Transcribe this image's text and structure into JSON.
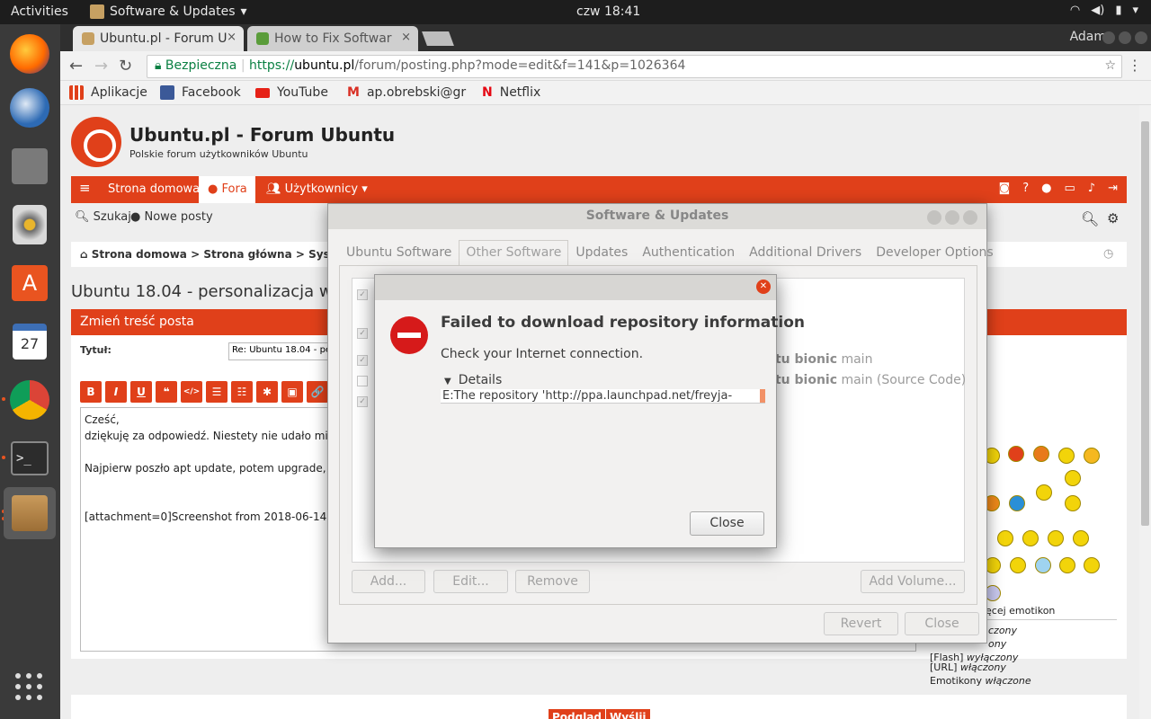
{
  "topbar": {
    "activities": "Activities",
    "app_name": "Software & Updates",
    "clock": "czw 18:41"
  },
  "dock": {
    "items": [
      "Firefox",
      "Thunderbird",
      "Files",
      "Rhythmbox",
      "Ubuntu Software",
      "Calendar",
      "Chrome",
      "Terminal",
      "Software & Updates"
    ],
    "calendar_day": "27"
  },
  "browser": {
    "tabs": [
      {
        "label": "Ubuntu.pl - Forum U",
        "close": "×"
      },
      {
        "label": "How to Fix Softwar",
        "close": "×"
      }
    ],
    "user": "Adam",
    "address": {
      "secure_label": "Bezpieczna",
      "scheme": "https://",
      "host": "ubuntu.pl",
      "path": "/forum/posting.php?mode=edit&f=141&p=1026364"
    },
    "bookmarks": [
      {
        "label": "Aplikacje",
        "color": "#e0401a"
      },
      {
        "label": "Facebook",
        "color": "#3b5998"
      },
      {
        "label": "YouTube",
        "color": "#e62117"
      },
      {
        "label": "ap.obrebski@gr",
        "color": "#d93025"
      },
      {
        "label": "Netflix",
        "color": "#e50914"
      }
    ]
  },
  "forum": {
    "title": "Ubuntu.pl - Forum Ubuntu",
    "subtitle": "Polskie forum użytkowników Ubuntu",
    "nav": [
      "Strona domowa",
      "Fora",
      "Użytkownicy"
    ],
    "search": "Szukaj",
    "new_posts": "Nowe posty",
    "breadcrumb": "Strona domowa > Strona główna > System > Środ",
    "topic_title": "Ubuntu 18.04 - personalizacja wyg",
    "edit_header": "Zmień treść posta",
    "tytul_label": "Tytuł:",
    "tytul_value": "Re: Ubuntu 18.04 - pe",
    "fmt_buttons": [
      "B",
      "I",
      "U",
      "❝",
      "</>",
      "☰",
      "☷",
      "✱",
      "▣",
      "🔗"
    ],
    "post_lines": [
      "Cześć,",
      "dziękuję za odpowiedź. Niestety nie udało mi s",
      "",
      "Najpierw poszło apt update, potem upgrade, a",
      "",
      "",
      "[attachment=0]Screenshot from 2018-06-14 18"
    ],
    "more_emoticons": "ęcej emotikon",
    "side_lines": [
      {
        "prefix": "",
        "value": "czony"
      },
      {
        "prefix": "",
        "value": "ony"
      },
      {
        "prefix": "[Flash] ",
        "value": "wyłączony"
      },
      {
        "prefix": "[URL] ",
        "value": "włączony"
      },
      {
        "prefix": "Emotikony ",
        "value": "włączone"
      }
    ],
    "preview_button": "Podgląd",
    "submit_button": "Wyślij"
  },
  "software_window": {
    "title": "Software & Updates",
    "tabs": [
      "Ubuntu Software",
      "Other Software",
      "Updates",
      "Authentication",
      "Additional Drivers",
      "Developer Options"
    ],
    "active_tab": "Other Software",
    "rows": [
      {
        "checked": true,
        "distro": "",
        "component": ""
      },
      {
        "checked": true,
        "distro": "",
        "component": ""
      },
      {
        "checked": true,
        "distro": "ntu bionic",
        "component": "main"
      },
      {
        "checked": false,
        "distro": "ntu bionic",
        "component": "main (Source Code)"
      },
      {
        "checked": true,
        "distro": "",
        "component": ""
      }
    ],
    "buttons": {
      "add": "Add...",
      "edit": "Edit...",
      "remove": "Remove",
      "add_volume": "Add Volume..."
    },
    "footer": {
      "revert": "Revert",
      "close": "Close"
    }
  },
  "error_dialog": {
    "title": "Failed to download repository information",
    "message": "Check your Internet connection.",
    "details_label": "Details",
    "details_text": "E:The repository 'http://ppa.launchpad.net/freyja-",
    "close_button": "Close"
  }
}
